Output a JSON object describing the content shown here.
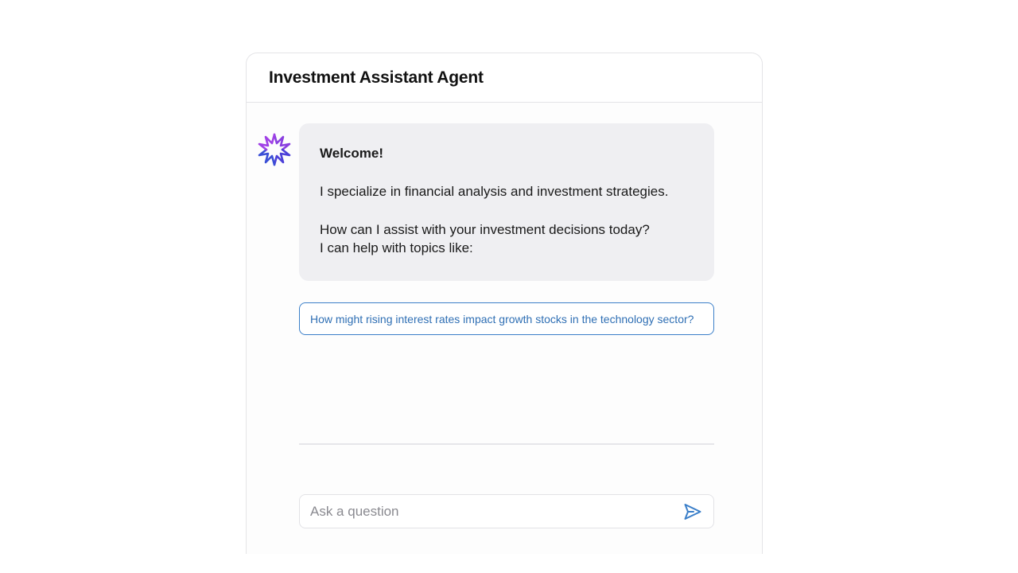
{
  "header": {
    "title": "Investment Assistant Agent"
  },
  "assistant": {
    "avatar_icon": "sparkle-icon",
    "message": {
      "greeting": "Welcome!",
      "line1": "I specialize in financial analysis and investment strategies.",
      "line2": "How can I assist with your investment decisions today?",
      "line3": "I can help with topics like:"
    }
  },
  "suggestions": [
    {
      "label": "How might rising interest rates impact growth stocks in the technology sector?"
    }
  ],
  "composer": {
    "placeholder": "Ask a question",
    "value": "",
    "send_icon": "send-icon"
  },
  "colors": {
    "accent": "#3b7fc9",
    "bubble_bg": "#efeff2",
    "avatar_primary": "#7b3fe4",
    "avatar_secondary": "#2e4fd1"
  }
}
